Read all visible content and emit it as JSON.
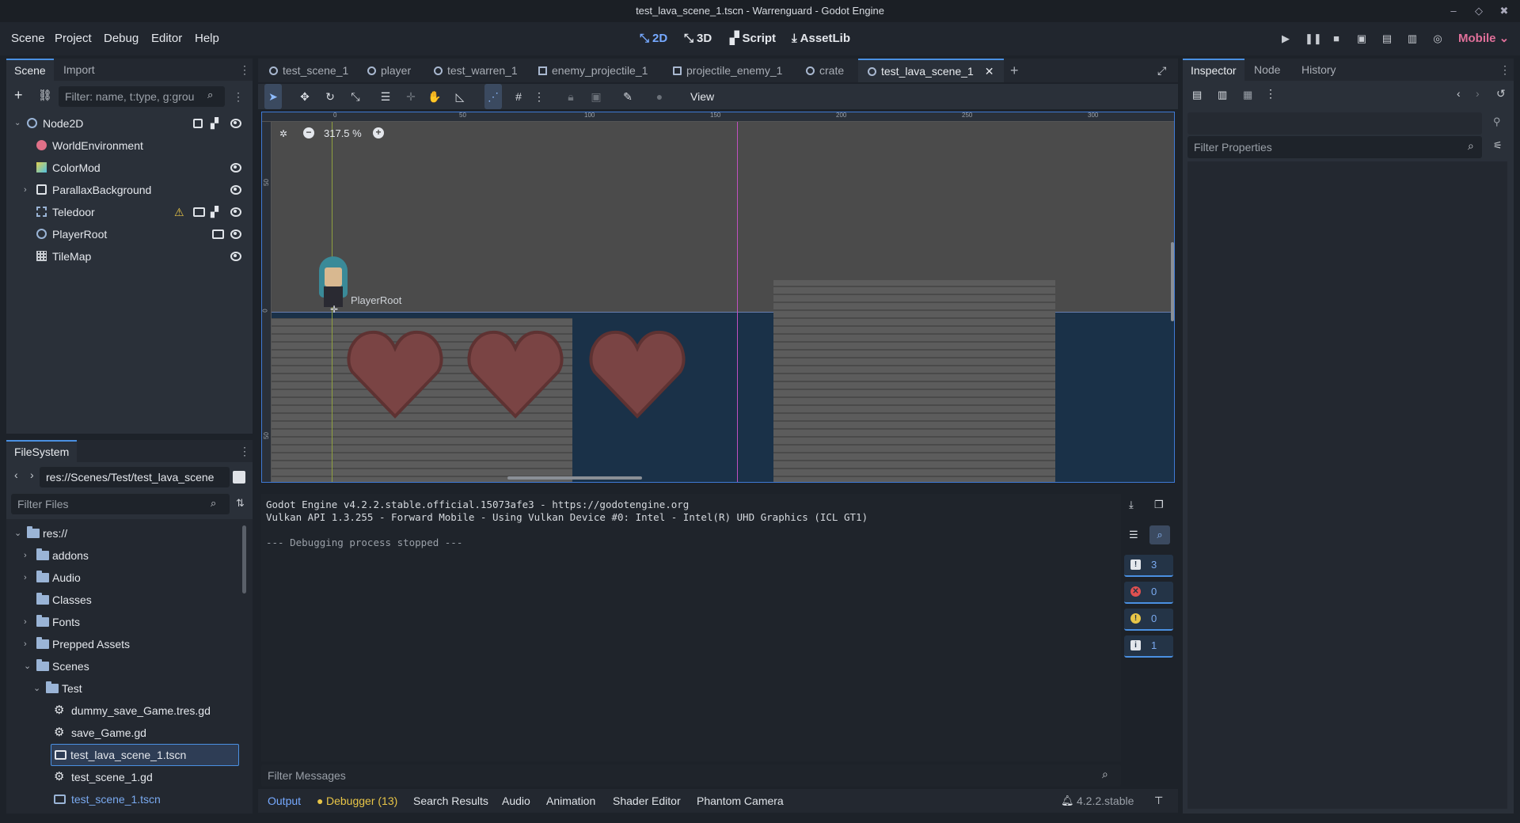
{
  "window": {
    "title": "test_lava_scene_1.tscn - Warrenguard - Godot Engine"
  },
  "menus": [
    "Scene",
    "Project",
    "Debug",
    "Editor",
    "Help"
  ],
  "workspaces": [
    {
      "label": "2D",
      "icon": "2d-icon",
      "active": true
    },
    {
      "label": "3D",
      "icon": "3d-icon",
      "active": false
    },
    {
      "label": "Script",
      "icon": "script-icon",
      "active": false
    },
    {
      "label": "AssetLib",
      "icon": "assetlib-icon",
      "active": false
    }
  ],
  "renderer": "Mobile",
  "scene_dock": {
    "tabs": [
      "Scene",
      "Import"
    ],
    "filter_placeholder": "Filter: name, t:type, g:grou",
    "nodes": [
      {
        "label": "Node2D",
        "icon": "node2d-icon"
      },
      {
        "label": "WorldEnvironment",
        "icon": "world-environment-icon"
      },
      {
        "label": "ColorMod",
        "icon": "canvas-modulate-icon"
      },
      {
        "label": "ParallaxBackground",
        "icon": "parallax-background-icon"
      },
      {
        "label": "Teledoor",
        "icon": "area2d-icon"
      },
      {
        "label": "PlayerRoot",
        "icon": "node2d-icon"
      },
      {
        "label": "TileMap",
        "icon": "tilemap-icon"
      }
    ]
  },
  "filesystem_dock": {
    "tab": "FileSystem",
    "path": "res://Scenes/Test/test_lava_scene",
    "filter_placeholder": "Filter Files",
    "items": [
      {
        "label": "res://",
        "type": "folder"
      },
      {
        "label": "addons",
        "type": "folder"
      },
      {
        "label": "Audio",
        "type": "folder"
      },
      {
        "label": "Classes",
        "type": "folder"
      },
      {
        "label": "Fonts",
        "type": "folder"
      },
      {
        "label": "Prepped Assets",
        "type": "folder"
      },
      {
        "label": "Scenes",
        "type": "folder"
      },
      {
        "label": "Test",
        "type": "folder"
      },
      {
        "label": "dummy_save_Game.tres.gd",
        "type": "script"
      },
      {
        "label": "save_Game.gd",
        "type": "script"
      },
      {
        "label": "test_lava_scene_1.tscn",
        "type": "scene",
        "selected": true
      },
      {
        "label": "test_scene_1.gd",
        "type": "script"
      },
      {
        "label": "test_scene_1.tscn",
        "type": "scene"
      }
    ]
  },
  "editor_tabs": [
    {
      "label": "test_scene_1",
      "icon": "node2d-icon"
    },
    {
      "label": "player",
      "icon": "node2d-icon"
    },
    {
      "label": "test_warren_1",
      "icon": "node2d-icon"
    },
    {
      "label": "enemy_projectile_1",
      "icon": "area2d-icon"
    },
    {
      "label": "projectile_enemy_1",
      "icon": "control-icon"
    },
    {
      "label": "crate",
      "icon": "rigidbody-icon"
    },
    {
      "label": "test_lava_scene_1",
      "icon": "node2d-icon",
      "active": true
    }
  ],
  "toolbar": {
    "view_label": "View"
  },
  "viewport": {
    "zoom": "317.5 %",
    "ruler_marks": [
      "0",
      "50",
      "100",
      "150",
      "200",
      "250",
      "300"
    ],
    "ruler_v_marks": [
      "50",
      "0",
      "50"
    ],
    "node_label": "PlayerRoot"
  },
  "output": {
    "lines": [
      "Godot Engine v4.2.2.stable.official.15073afe3 - https://godotengine.org",
      "Vulkan API 1.3.255 - Forward Mobile - Using Vulkan Device #0: Intel - Intel(R) UHD Graphics (ICL GT1)",
      "",
      "--- Debugging process stopped ---"
    ],
    "filter_placeholder": "Filter Messages",
    "counts": {
      "messages": "3",
      "errors": "0",
      "warnings": "0",
      "editor": "1"
    }
  },
  "bottom_tabs": [
    "Output",
    "Debugger (13)",
    "Search Results",
    "Audio",
    "Animation",
    "Shader Editor",
    "Phantom Camera"
  ],
  "version": "4.2.2.stable",
  "inspector": {
    "tabs": [
      "Inspector",
      "Node",
      "History"
    ],
    "filter_placeholder": "Filter Properties"
  },
  "colors": {
    "accent": "#4a90e2",
    "warning": "#e8c547",
    "error": "#e05050"
  }
}
